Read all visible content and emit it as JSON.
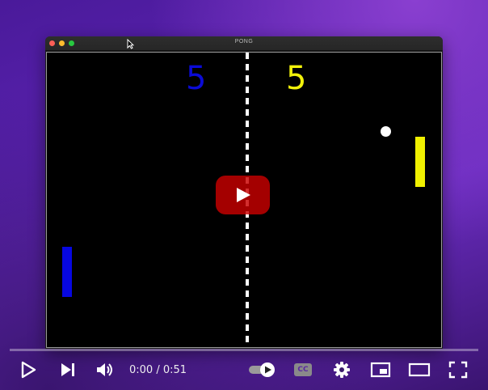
{
  "window": {
    "title": "PONG"
  },
  "game": {
    "score_left": "5",
    "score_right": "5"
  },
  "colors": {
    "left_player": "#0707e0",
    "right_player": "#f0f000",
    "ball": "#ffffff",
    "net": "#ffffff"
  },
  "player": {
    "time": "0:00 / 0:51",
    "cc_label": "CC",
    "progress": 0
  },
  "icons": {
    "play": "play-icon",
    "next": "next-icon",
    "volume": "volume-icon",
    "autoplay": "autoplay-toggle-icon",
    "captions": "captions-icon",
    "settings": "gear-icon",
    "miniplayer": "miniplayer-icon",
    "theater": "theater-mode-icon",
    "fullscreen": "fullscreen-icon"
  }
}
